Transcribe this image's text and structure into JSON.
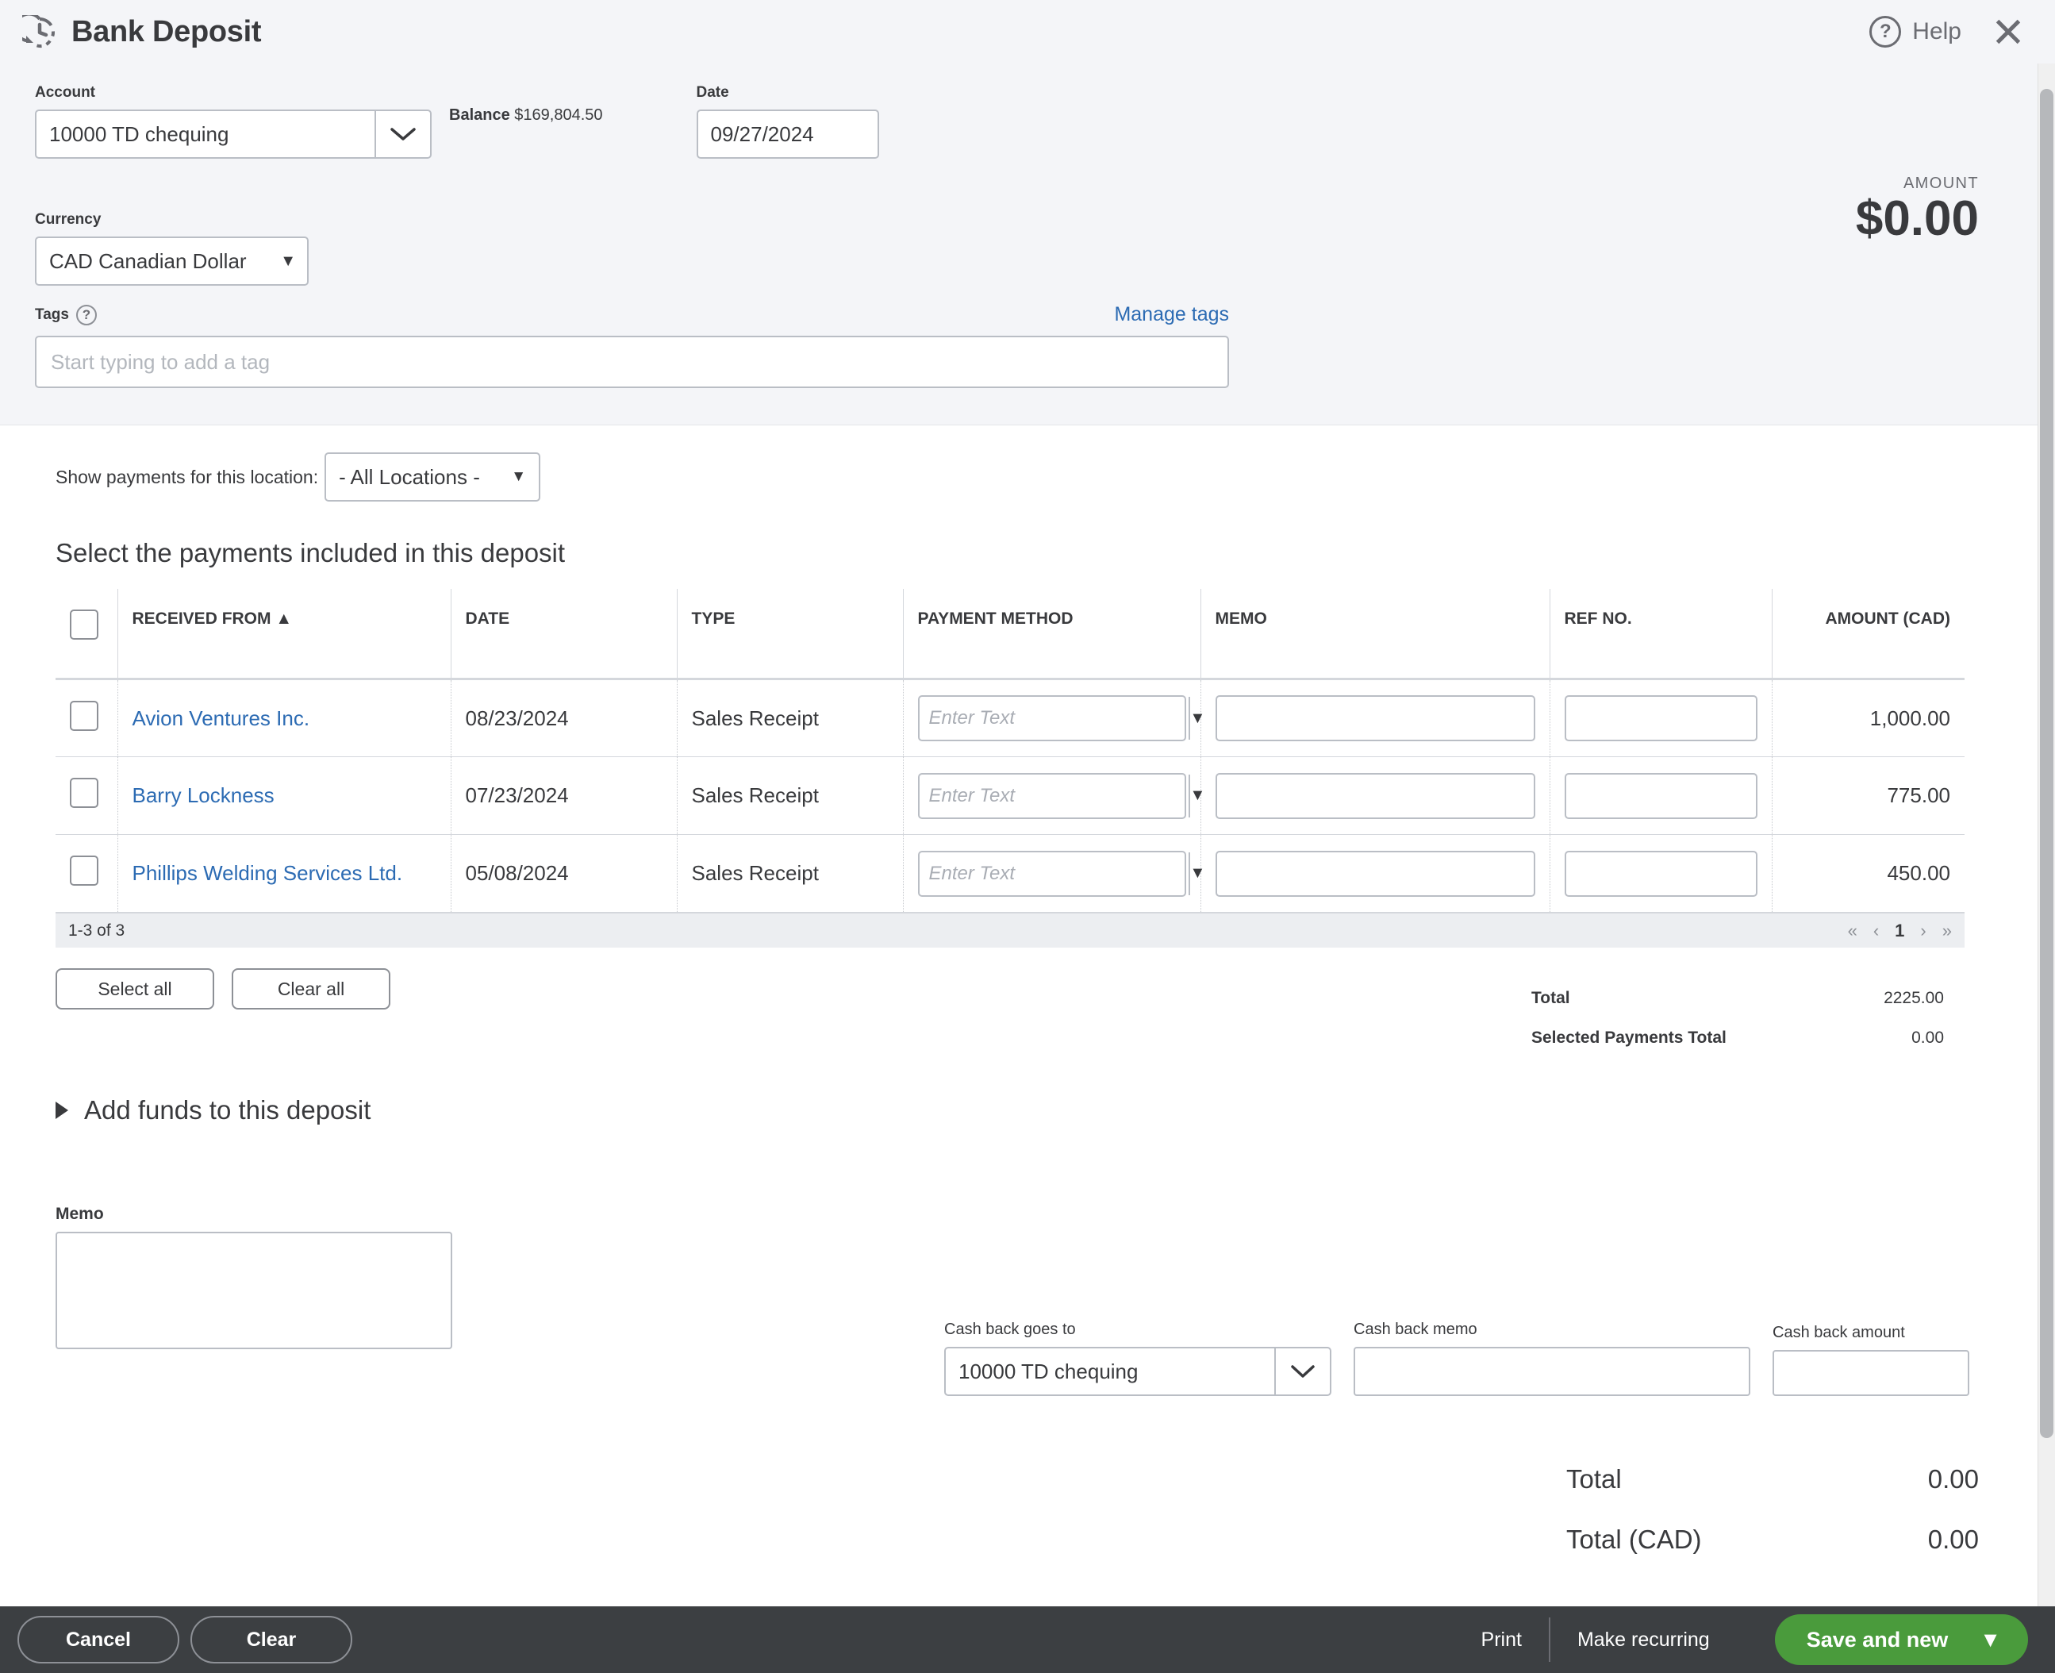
{
  "header": {
    "title": "Bank Deposit",
    "recurring_icon": "history-clock-icon",
    "help_label": "Help",
    "help_icon": "question-circle-icon",
    "close_icon": "close-icon"
  },
  "form": {
    "account_label": "Account",
    "account_value": "10000 TD chequing",
    "balance_label": "Balance",
    "balance_value": "$169,804.50",
    "date_label": "Date",
    "date_value": "09/27/2024",
    "amount_label": "AMOUNT",
    "amount_value": "$0.00",
    "currency_label": "Currency",
    "currency_value": "CAD Canadian Dollar",
    "tags_label": "Tags",
    "tags_placeholder": "Start typing to add a tag",
    "manage_tags_label": "Manage tags"
  },
  "payments_section": {
    "location_label": "Show payments for this location:",
    "location_value": "- All Locations -",
    "section_title": "Select the payments included in this deposit",
    "columns": [
      "RECEIVED FROM",
      "DATE",
      "TYPE",
      "PAYMENT METHOD",
      "MEMO",
      "REF NO.",
      "AMOUNT (CAD)"
    ],
    "sort_indicator": "▲",
    "payment_method_placeholder": "Enter Text",
    "rows": [
      {
        "received_from": "Avion Ventures Inc.",
        "date": "08/23/2024",
        "type": "Sales Receipt",
        "payment_method": "",
        "memo": "",
        "ref_no": "",
        "amount": "1,000.00",
        "checked": false
      },
      {
        "received_from": "Barry Lockness",
        "date": "07/23/2024",
        "type": "Sales Receipt",
        "payment_method": "",
        "memo": "",
        "ref_no": "",
        "amount": "775.00",
        "checked": false
      },
      {
        "received_from": "Phillips Welding Services Ltd.",
        "date": "05/08/2024",
        "type": "Sales Receipt",
        "payment_method": "",
        "memo": "",
        "ref_no": "",
        "amount": "450.00",
        "checked": false
      }
    ],
    "pager_text": "1-3 of 3",
    "pager_first": "«",
    "pager_prev": "‹",
    "pager_page": "1",
    "pager_next": "›",
    "pager_last": "»",
    "select_all_label": "Select all",
    "clear_all_label": "Clear all",
    "total_label": "Total",
    "total_value": "2225.00",
    "selected_total_label": "Selected Payments Total",
    "selected_total_value": "0.00"
  },
  "add_funds": {
    "label": "Add funds to this deposit",
    "expander_icon": "triangle-right-icon"
  },
  "memo": {
    "label": "Memo",
    "value": ""
  },
  "cash_back": {
    "goes_to_label": "Cash back goes to",
    "goes_to_value": "10000 TD chequing",
    "memo_label": "Cash back memo",
    "memo_value": "",
    "amount_label": "Cash back amount",
    "amount_value": ""
  },
  "grand_totals": {
    "total_label": "Total",
    "total_value": "0.00",
    "total_cad_label": "Total (CAD)",
    "total_cad_value": "0.00"
  },
  "footer": {
    "cancel_label": "Cancel",
    "clear_label": "Clear",
    "print_label": "Print",
    "make_recurring_label": "Make recurring",
    "save_label": "Save and new",
    "save_caret_icon": "caret-down-icon"
  },
  "colors": {
    "accent_link": "#2c6bb3",
    "save_green": "#4a9b3c",
    "footer_bg": "#3c3f42",
    "panel_bg": "#f4f5f8"
  }
}
